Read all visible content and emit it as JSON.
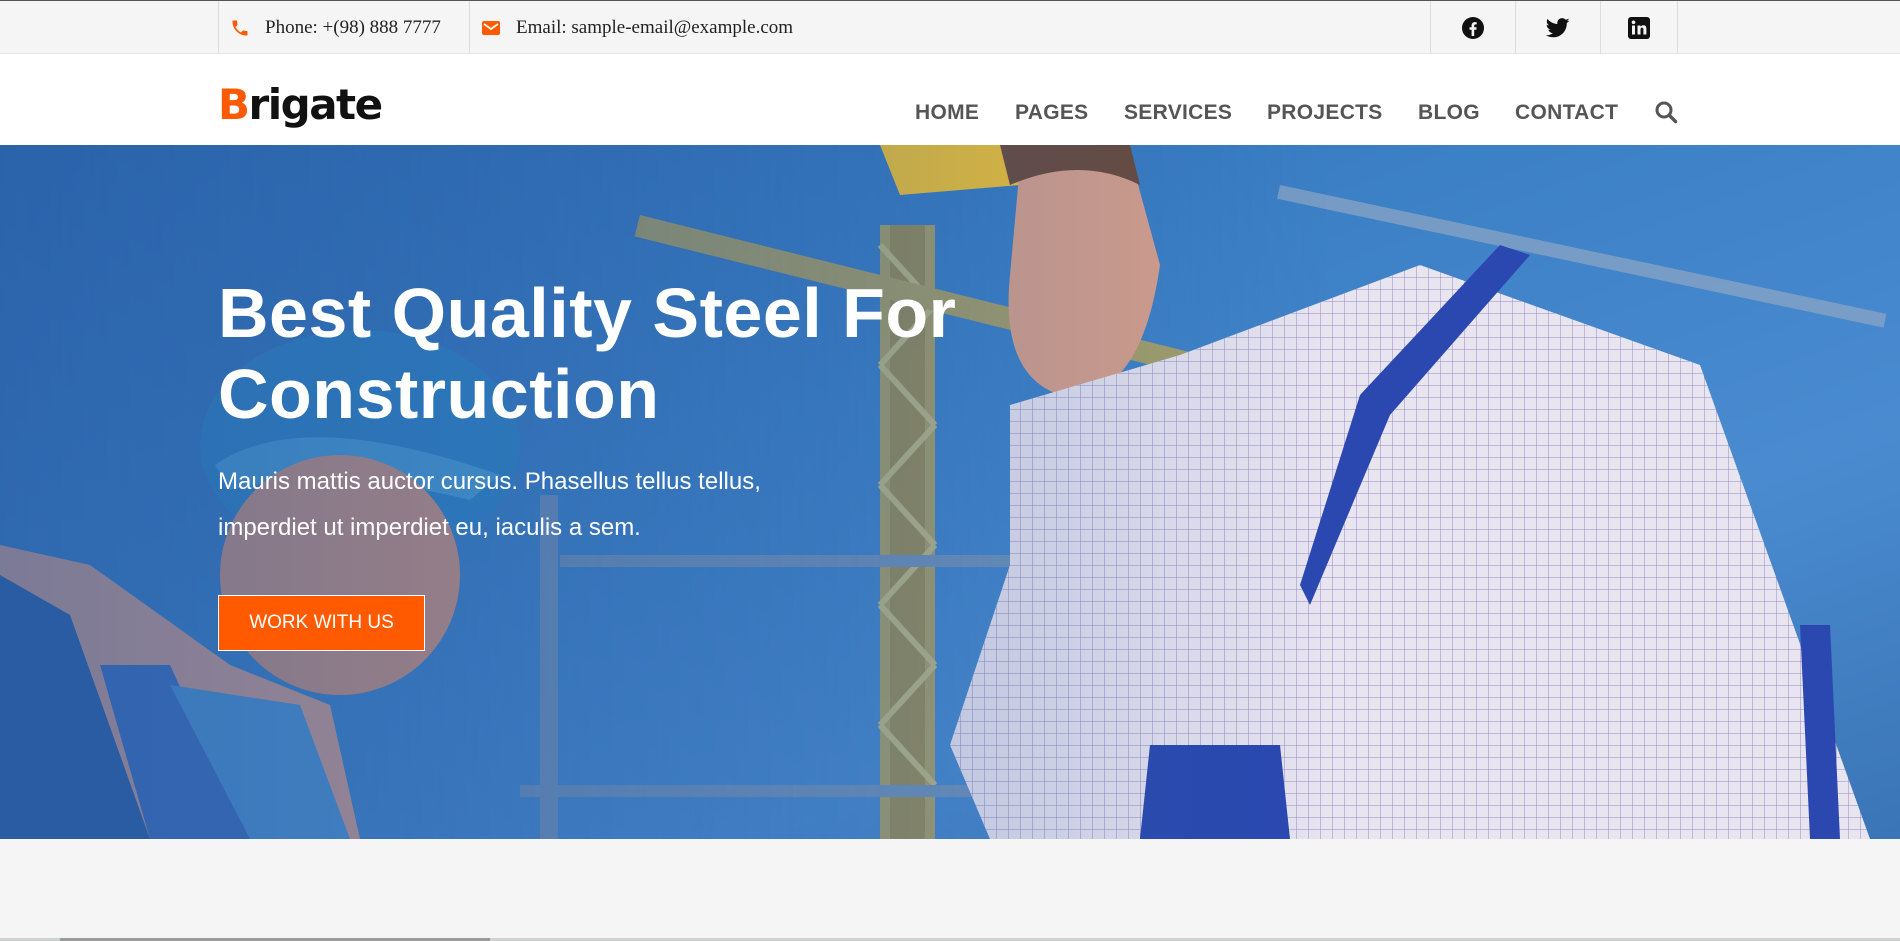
{
  "topbar": {
    "phone": "Phone: +(98) 888 7777",
    "email": "Email: sample-email@example.com",
    "phone_icon": "phone-icon",
    "email_icon": "envelope-icon",
    "social": [
      "facebook-icon",
      "twitter-icon",
      "linkedin-icon"
    ]
  },
  "header": {
    "logo_first": "B",
    "logo_rest": "rigate",
    "nav": [
      "HOME",
      "PAGES",
      "SERVICES",
      "PROJECTS",
      "BLOG",
      "CONTACT"
    ],
    "search_icon": "search-icon"
  },
  "hero": {
    "title": "Best Quality Steel For Construction",
    "subtitle": "Mauris mattis auctor cursus. Phasellus tellus tellus, imperdiet ut imperdiet eu, iaculis a sem.",
    "button": "WORK WITH US"
  },
  "colors": {
    "accent": "#ff5a00",
    "nav_text": "#555555",
    "topbar_bg": "#f4f5f4",
    "hero_overlay": "#2f6fb7"
  }
}
